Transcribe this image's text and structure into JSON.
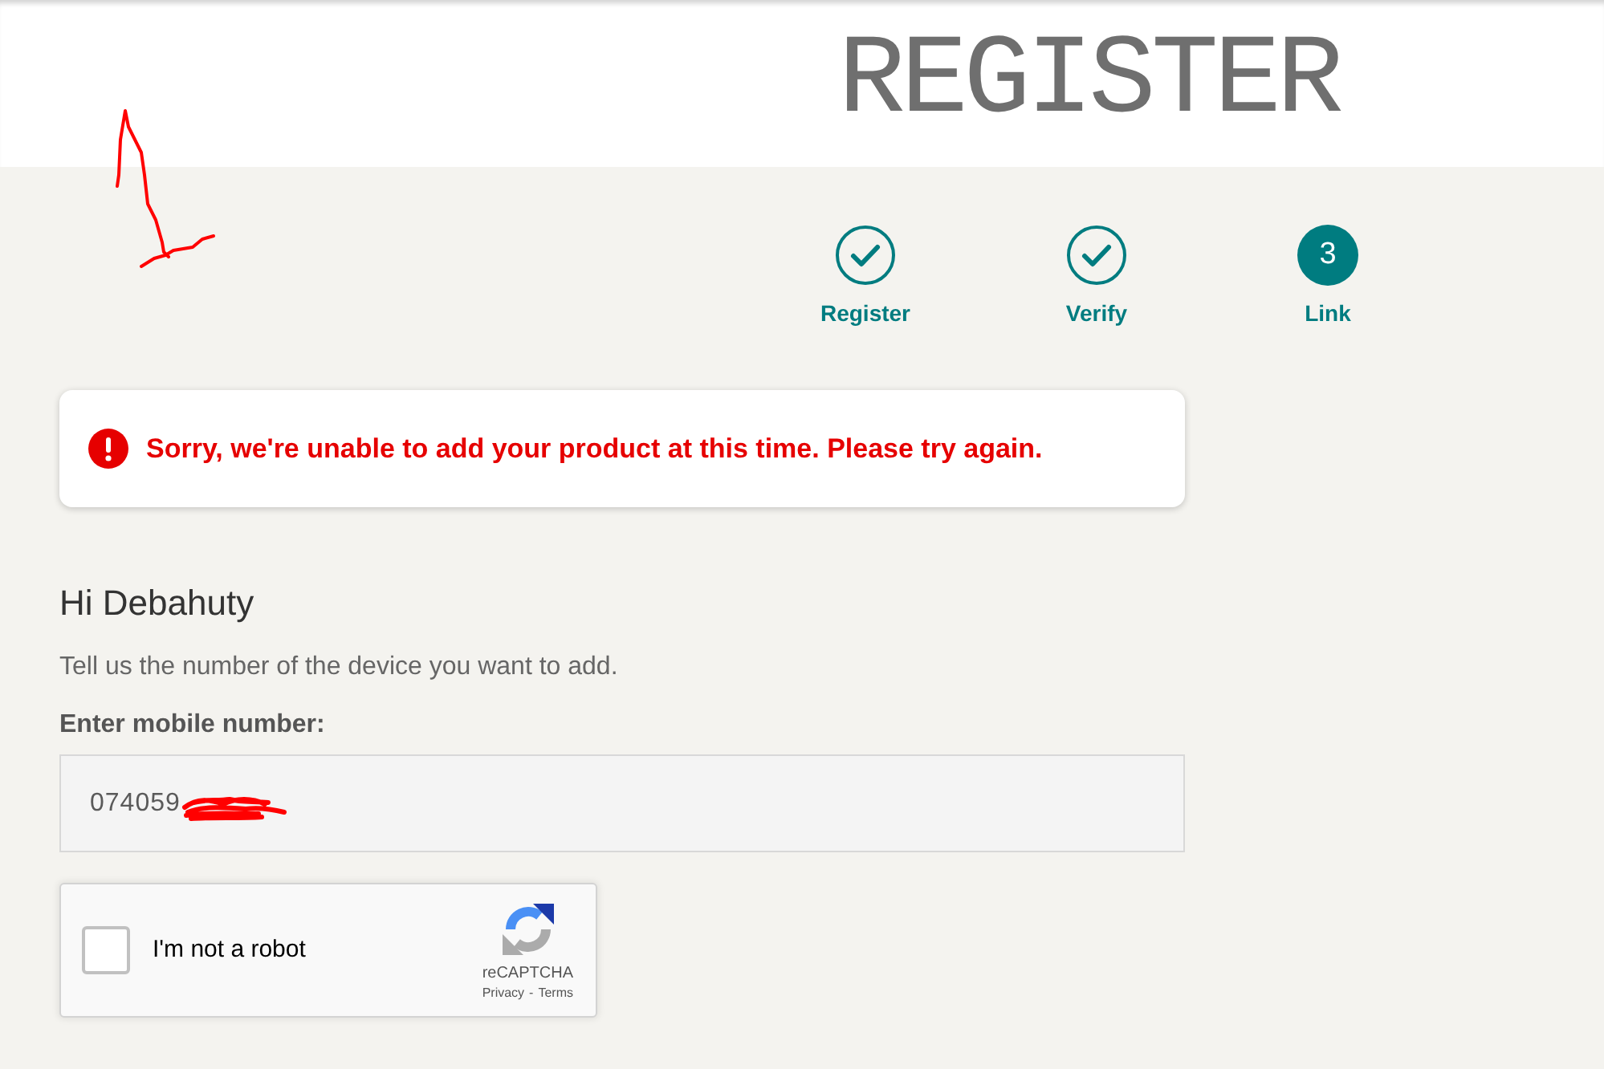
{
  "header": {
    "title": "REGISTER"
  },
  "steps": [
    {
      "label": "Register",
      "completed": true
    },
    {
      "label": "Verify",
      "completed": true
    },
    {
      "label": "Link",
      "number": "3",
      "completed": false
    }
  ],
  "alert": {
    "kind": "error",
    "message": "Sorry, we're unable to add your product at this time. Please try again."
  },
  "greeting": "Hi Debahuty",
  "instructions": "Tell us the number of the device you want to add.",
  "phone_field": {
    "label": "Enter mobile number:",
    "value": "074059",
    "redacted": true
  },
  "captcha": {
    "checked": false,
    "label": "I'm not a robot",
    "brand": "reCAPTCHA",
    "links": [
      "Privacy",
      "Terms"
    ],
    "separator": "-"
  }
}
